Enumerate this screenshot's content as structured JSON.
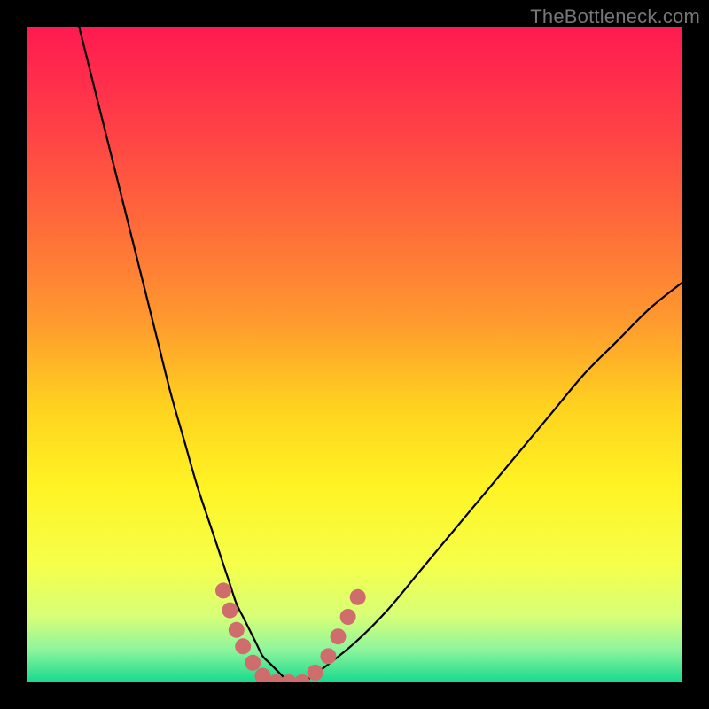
{
  "watermark": {
    "text": "TheBottleneck.com"
  },
  "chart_data": {
    "type": "line",
    "title": "",
    "xlabel": "",
    "ylabel": "",
    "xlim": [
      0,
      100
    ],
    "ylim": [
      0,
      100
    ],
    "series": [
      {
        "name": "bottleneck-curve",
        "x": [
          8,
          10,
          12,
          14,
          16,
          18,
          20,
          22,
          24,
          26,
          28,
          30,
          31,
          32,
          33,
          34,
          35,
          36,
          37,
          38,
          39,
          40,
          42,
          45,
          50,
          55,
          60,
          65,
          70,
          75,
          80,
          85,
          90,
          95,
          100
        ],
        "y": [
          100,
          92,
          84,
          76,
          68,
          60,
          52,
          44,
          37,
          30,
          24,
          18,
          15,
          12,
          10,
          8,
          6,
          4,
          3,
          2,
          1,
          0,
          0,
          2,
          6,
          11,
          17,
          23,
          29,
          35,
          41,
          47,
          52,
          57,
          61
        ]
      }
    ],
    "markers": {
      "name": "highlight-dots",
      "color": "#cf6d6d",
      "points": [
        {
          "x": 30.0,
          "y": 14.0
        },
        {
          "x": 31.0,
          "y": 11.0
        },
        {
          "x": 32.0,
          "y": 8.0
        },
        {
          "x": 33.0,
          "y": 5.5
        },
        {
          "x": 34.5,
          "y": 3.0
        },
        {
          "x": 36.0,
          "y": 1.0
        },
        {
          "x": 38.0,
          "y": 0.0
        },
        {
          "x": 40.0,
          "y": 0.0
        },
        {
          "x": 42.0,
          "y": 0.0
        },
        {
          "x": 44.0,
          "y": 1.5
        },
        {
          "x": 46.0,
          "y": 4.0
        },
        {
          "x": 47.5,
          "y": 7.0
        },
        {
          "x": 49.0,
          "y": 10.0
        },
        {
          "x": 50.5,
          "y": 13.0
        }
      ]
    },
    "gradient_stops": [
      {
        "offset": 0.0,
        "color": "#ff1a50"
      },
      {
        "offset": 0.15,
        "color": "#ff3f47"
      },
      {
        "offset": 0.3,
        "color": "#ff6a3a"
      },
      {
        "offset": 0.45,
        "color": "#ff9a2e"
      },
      {
        "offset": 0.58,
        "color": "#ffd21f"
      },
      {
        "offset": 0.7,
        "color": "#fff324"
      },
      {
        "offset": 0.82,
        "color": "#f6ff4a"
      },
      {
        "offset": 0.9,
        "color": "#d6ff78"
      },
      {
        "offset": 0.95,
        "color": "#8ef59c"
      },
      {
        "offset": 1.0,
        "color": "#17d98e"
      }
    ]
  }
}
